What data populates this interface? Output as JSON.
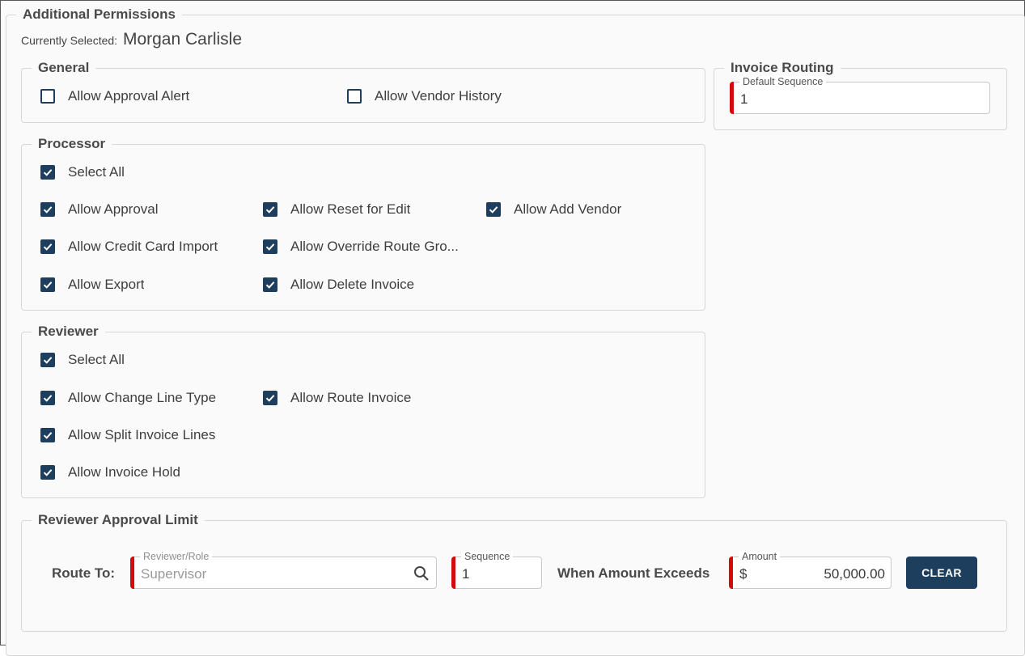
{
  "title": "Additional Permissions",
  "current": {
    "label": "Currently Selected:",
    "name": "Morgan Carlisle"
  },
  "general": {
    "title": "General",
    "items": [
      {
        "label": "Allow Approval Alert",
        "checked": false
      },
      {
        "label": "Allow Vendor History",
        "checked": false
      }
    ]
  },
  "processor": {
    "title": "Processor",
    "select_all": "Select All",
    "items": [
      {
        "label": "Allow Approval",
        "checked": true
      },
      {
        "label": "Allow Reset for Edit",
        "checked": true
      },
      {
        "label": "Allow Add Vendor",
        "checked": true
      },
      {
        "label": "Allow Credit Card Import",
        "checked": true
      },
      {
        "label": "Allow Override Route Gro...",
        "checked": true
      },
      {
        "label": "Allow Export",
        "checked": true
      },
      {
        "label": "Allow Delete Invoice",
        "checked": true
      }
    ]
  },
  "reviewer": {
    "title": "Reviewer",
    "select_all": "Select All",
    "items": [
      {
        "label": "Allow Change Line Type",
        "checked": true
      },
      {
        "label": "Allow Route Invoice",
        "checked": true
      },
      {
        "label": "Allow Split Invoice Lines",
        "checked": true
      },
      {
        "label": "Allow Invoice Hold",
        "checked": true
      }
    ]
  },
  "routing": {
    "title": "Invoice Routing",
    "default_sequence_label": "Default Sequence",
    "default_sequence_value": "1"
  },
  "limit": {
    "title": "Reviewer Approval Limit",
    "route_to": "Route To:",
    "reviewer_label": "Reviewer/Role",
    "reviewer_placeholder": "Supervisor",
    "sequence_label": "Sequence",
    "sequence_value": "1",
    "when_exceeds": "When Amount Exceeds",
    "amount_label": "Amount",
    "currency": "$",
    "amount_value": "50,000.00",
    "clear": "CLEAR"
  },
  "colors": {
    "accent": "#1d3e5c",
    "required": "#d40b0b"
  }
}
